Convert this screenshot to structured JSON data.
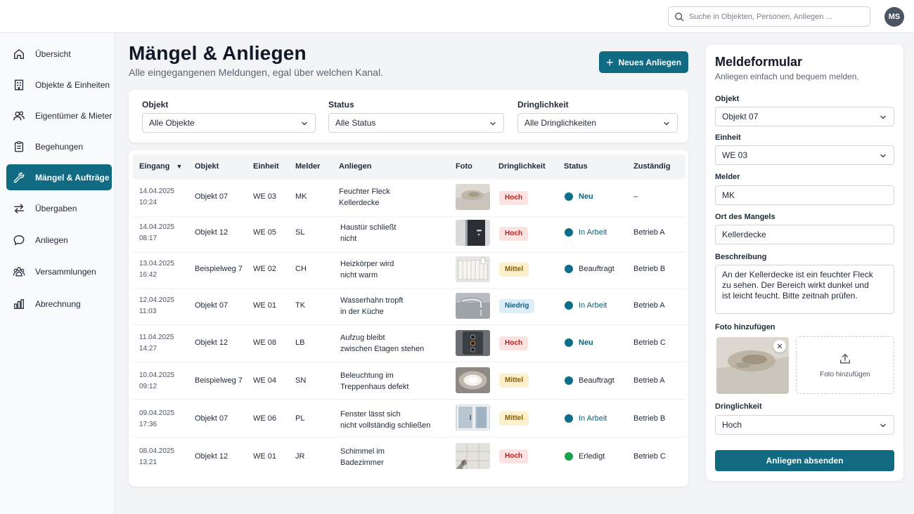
{
  "search": {
    "placeholder": "Suche in Objekten, Personen, Anliegen ..."
  },
  "user": {
    "initials": "MS"
  },
  "sidebar": {
    "items": [
      {
        "label": "Übersicht",
        "icon": "home-icon"
      },
      {
        "label": "Objekte & Einheiten",
        "icon": "building-icon"
      },
      {
        "label": "Eigentümer & Mieter",
        "icon": "users-icon"
      },
      {
        "label": "Begehungen",
        "icon": "clipboard-icon"
      },
      {
        "label": "Mängel & Aufträge",
        "icon": "wrench-icon",
        "active": true
      },
      {
        "label": "Übergaben",
        "icon": "swap-arrows-icon"
      },
      {
        "label": "Anliegen",
        "icon": "chat-bubble-icon"
      },
      {
        "label": "Versammlungen",
        "icon": "group-icon"
      },
      {
        "label": "Abrechnung",
        "icon": "bar-chart-icon"
      }
    ]
  },
  "header": {
    "title": "Mängel & Anliegen",
    "subtitle": "Alle eingegangenen Meldungen, egal über welchen Kanal.",
    "new_button": "Neues Anliegen"
  },
  "filters": {
    "objekt": {
      "label": "Objekt",
      "value": "Alle Objekte"
    },
    "status": {
      "label": "Status",
      "value": "Alle Status"
    },
    "dringlichkeit": {
      "label": "Dringlichkeit",
      "value": "Alle Dringlichkeiten"
    }
  },
  "table": {
    "columns": {
      "eingang": "Eingang",
      "objekt": "Objekt",
      "einheit": "Einheit",
      "melder": "Melder",
      "anliegen": "Anliegen",
      "foto": "Foto",
      "dringlichkeit": "Dringlichkeit",
      "status": "Status",
      "zustaendig": "Zuständig"
    },
    "rows": [
      {
        "date": "14.04.2025",
        "time": "10:24",
        "objekt": "Objekt 07",
        "einheit": "WE 03",
        "melder": "MK",
        "anliegen1": "Feuchter Fleck",
        "anliegen2": "Kellerdecke",
        "photo": "damp-ceiling",
        "dringlichkeit": "Hoch",
        "status": "Neu",
        "zustaendig": "–"
      },
      {
        "date": "14.04.2025",
        "time": "08:17",
        "objekt": "Objekt 12",
        "einheit": "WE 05",
        "melder": "SL",
        "anliegen1": "Haustür schließt",
        "anliegen2": "nicht",
        "photo": "door",
        "dringlichkeit": "Hoch",
        "status": "In Arbeit",
        "zustaendig": "Betrieb A"
      },
      {
        "date": "13.04.2025",
        "time": "16:42",
        "objekt": "Beispielweg 7",
        "einheit": "WE 02",
        "melder": "CH",
        "anliegen1": "Heizkörper wird",
        "anliegen2": "nicht warm",
        "photo": "radiator",
        "dringlichkeit": "Mittel",
        "status": "Beauftragt",
        "zustaendig": "Betrieb B"
      },
      {
        "date": "12.04.2025",
        "time": "11:03",
        "objekt": "Objekt 07",
        "einheit": "WE 01",
        "melder": "TK",
        "anliegen1": "Wasserhahn tropft",
        "anliegen2": "in der Küche",
        "photo": "faucet",
        "dringlichkeit": "Niedrig",
        "status": "In Arbeit",
        "zustaendig": "Betrieb A"
      },
      {
        "date": "11.04.2025",
        "time": "14:27",
        "objekt": "Objekt 12",
        "einheit": "WE 08",
        "melder": "LB",
        "anliegen1": "Aufzug bleibt",
        "anliegen2": "zwischen Etagen stehen",
        "photo": "elevator",
        "dringlichkeit": "Hoch",
        "status": "Neu",
        "zustaendig": "Betrieb C"
      },
      {
        "date": "10.04.2025",
        "time": "09:12",
        "objekt": "Beispielweg 7",
        "einheit": "WE 04",
        "melder": "SN",
        "anliegen1": "Beleuchtung im",
        "anliegen2": "Treppenhaus defekt",
        "photo": "lamp",
        "dringlichkeit": "Mittel",
        "status": "Beauftragt",
        "zustaendig": "Betrieb A"
      },
      {
        "date": "09.04.2025",
        "time": "17:36",
        "objekt": "Objekt 07",
        "einheit": "WE 06",
        "melder": "PL",
        "anliegen1": "Fenster lässt sich",
        "anliegen2": "nicht vollständig schließen",
        "photo": "window",
        "dringlichkeit": "Mittel",
        "status": "In Arbeit",
        "zustaendig": "Betrieb B"
      },
      {
        "date": "08.04.2025",
        "time": "13:21",
        "objekt": "Objekt 12",
        "einheit": "WE 01",
        "melder": "JR",
        "anliegen1": "Schimmel im",
        "anliegen2": "Badezimmer",
        "photo": "mold",
        "dringlichkeit": "Hoch",
        "status": "Erledigt",
        "zustaendig": "Betrieb C"
      }
    ]
  },
  "form": {
    "title": "Meldeformular",
    "subtitle": "Anliegen einfach und bequem melden.",
    "objekt_label": "Objekt",
    "objekt_value": "Objekt 07",
    "einheit_label": "Einheit",
    "einheit_value": "WE 03",
    "melder_label": "Melder",
    "melder_value": "MK",
    "ort_label": "Ort des Mangels",
    "ort_value": "Kellerdecke",
    "beschreibung_label": "Beschreibung",
    "beschreibung_value": "An der Kellerdecke ist ein feuchter Fleck\nzu sehen. Der Bereich wirkt dunkel und\nist leicht feucht. Bitte zeitnah prüfen.",
    "foto_label": "Foto hinzufügen",
    "foto_add": "Foto hinzufügen",
    "dringlichkeit_label": "Dringlichkeit",
    "dringlichkeit_value": "Hoch",
    "submit": "Anliegen absenden"
  },
  "colors": {
    "accent": "#106a82",
    "status_neu": "#0d6e8a",
    "status_in_arbeit": "#0d6e8a",
    "status_beauftragt": "#0d6e8a",
    "status_erledigt": "#16a34a",
    "hoch_bg": "#fde2e2",
    "mittel_bg": "#fdf0cc",
    "niedrig_bg": "#dbeefa"
  }
}
